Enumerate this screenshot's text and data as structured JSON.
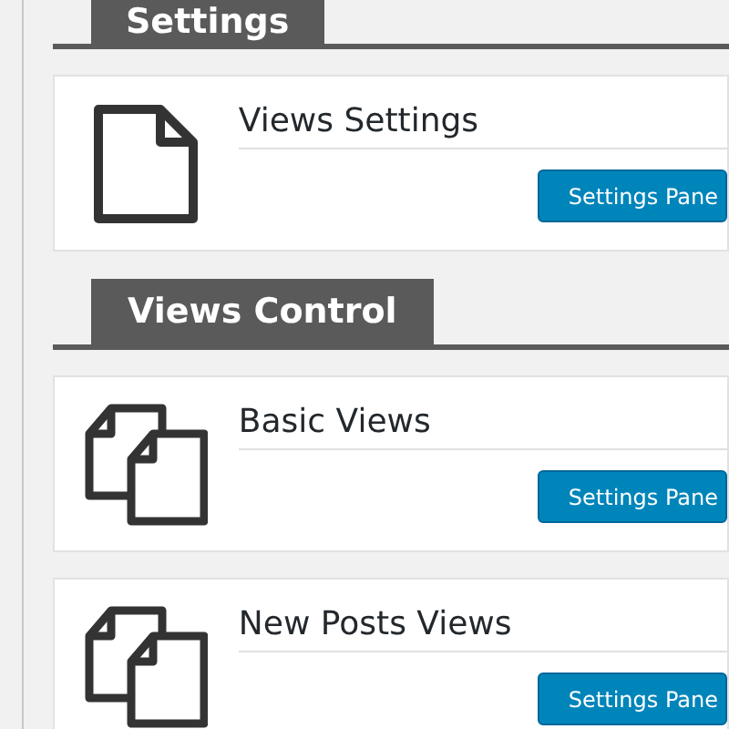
{
  "sections": [
    {
      "heading": "Settings",
      "cards": [
        {
          "kind": "page",
          "title": "Views Settings",
          "button": "Settings Pane"
        }
      ]
    },
    {
      "heading": "Views Control",
      "cards": [
        {
          "kind": "pages",
          "title": "Basic Views",
          "button": "Settings Pane"
        },
        {
          "kind": "pages",
          "title": "New Posts Views",
          "button": "Settings Pane"
        }
      ]
    }
  ]
}
